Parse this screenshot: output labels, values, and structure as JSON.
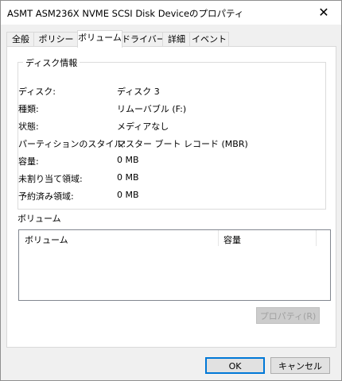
{
  "window": {
    "title": "ASMT ASM236X NVME SCSI Disk Deviceのプロパティ",
    "close_symbol": "✕"
  },
  "tabs": [
    {
      "label": "全般",
      "active": false
    },
    {
      "label": "ポリシー",
      "active": false
    },
    {
      "label": "ボリューム",
      "active": true
    },
    {
      "label": "ドライバー",
      "active": false
    },
    {
      "label": "詳細",
      "active": false
    },
    {
      "label": "イベント",
      "active": false
    }
  ],
  "disk_info": {
    "group_title": "ディスク情報",
    "rows": [
      {
        "label": "ディスク:",
        "value": "ディスク 3"
      },
      {
        "label": "種類:",
        "value": "リムーバブル (F:)"
      },
      {
        "label": "状態:",
        "value": "メディアなし"
      },
      {
        "label": "パーティションのスタイル:",
        "value": "マスター ブート レコード (MBR)"
      },
      {
        "label": "容量:",
        "value": "0 MB"
      },
      {
        "label": "未割り当て領域:",
        "value": "0 MB"
      },
      {
        "label": "予約済み領域:",
        "value": "0 MB"
      }
    ]
  },
  "volumes": {
    "heading": "ボリューム",
    "columns": [
      "ボリューム",
      "容量"
    ]
  },
  "buttons": {
    "properties": "プロパティ(R)",
    "ok": "OK",
    "cancel": "キャンセル"
  },
  "colors": {
    "accent": "#0078d7",
    "dialog_bg": "#f0f0f0",
    "disabled_text": "#a0a0a0"
  }
}
